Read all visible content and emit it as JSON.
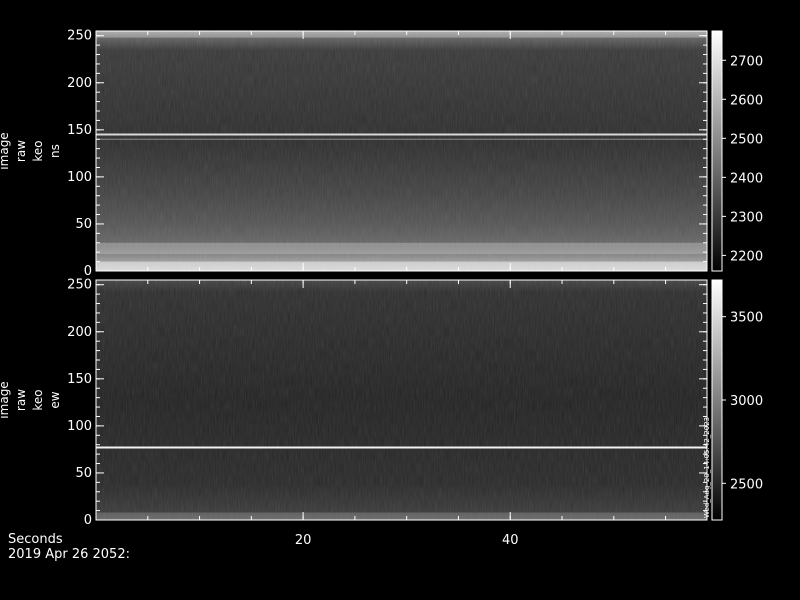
{
  "chart_data": [
    {
      "type": "heatmap",
      "ylabel": [
        "image",
        "raw",
        "keo",
        "ns"
      ],
      "x_range": [
        0,
        59
      ],
      "y_range": [
        0,
        255
      ],
      "xticks": [
        20,
        40
      ],
      "yticks": [
        0,
        50,
        100,
        150,
        200,
        250
      ],
      "colorbar": {
        "range": [
          2160,
          2775
        ],
        "ticks": [
          2200,
          2300,
          2400,
          2500,
          2600,
          2700
        ]
      },
      "features": [
        {
          "kind": "bright-line",
          "y": 145,
          "intensity": 0.85
        },
        {
          "kind": "line",
          "y": 140,
          "intensity": 0.55
        },
        {
          "kind": "bright-band",
          "y": [
            0,
            10
          ],
          "intensity": 0.95
        },
        {
          "kind": "band",
          "y": [
            18,
            30
          ],
          "intensity": 0.7
        },
        {
          "kind": "band",
          "y": [
            248,
            255
          ],
          "intensity": 0.75
        }
      ]
    },
    {
      "type": "heatmap",
      "ylabel": [
        "image",
        "raw",
        "keo",
        "ew"
      ],
      "x_range": [
        0,
        59
      ],
      "y_range": [
        0,
        255
      ],
      "xticks": [
        20,
        40
      ],
      "yticks": [
        0,
        50,
        100,
        150,
        200,
        250
      ],
      "colorbar": {
        "range": [
          2280,
          3720
        ],
        "ticks": [
          2500,
          3000,
          3500
        ]
      },
      "features": [
        {
          "kind": "bright-line",
          "y": 77,
          "intensity": 0.95
        },
        {
          "kind": "band",
          "y": [
            0,
            8
          ],
          "intensity": 0.5
        }
      ]
    }
  ],
  "x_axis_label": "Seconds",
  "timestamp": "2019 Apr 26 2052:",
  "colorbar_vertical_text": "Wed_Aug_20_14:05:42_2023",
  "colors": {
    "background": "#000000",
    "foreground": "#ffffff"
  }
}
